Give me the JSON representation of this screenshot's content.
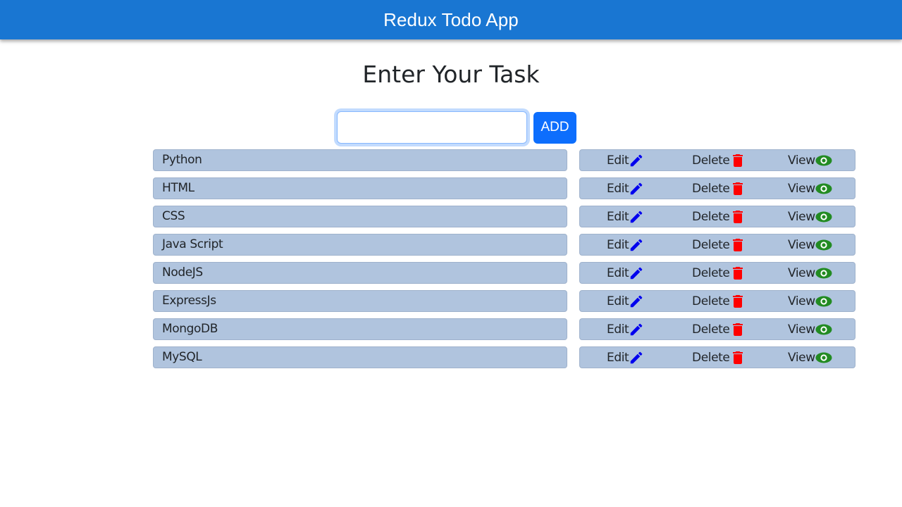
{
  "appbar": {
    "title": "Redux Todo App",
    "color": "#1976d2"
  },
  "heading": "Enter Your Task",
  "input": {
    "value": "",
    "placeholder": ""
  },
  "add_button": {
    "label": "ADD",
    "color": "#0d6efd"
  },
  "row_color": "#b0c4de",
  "actions": {
    "edit_label": "Edit",
    "edit_icon": "pencil-icon",
    "edit_color": "#0000ee",
    "delete_label": "Delete",
    "delete_icon": "trash-icon",
    "delete_color": "#ff0000",
    "view_label": "View",
    "view_icon": "eye-icon",
    "view_color": "#228b22"
  },
  "tasks": [
    {
      "name": "Python"
    },
    {
      "name": "HTML"
    },
    {
      "name": "CSS"
    },
    {
      "name": "Java Script"
    },
    {
      "name": "NodeJS"
    },
    {
      "name": "ExpressJs"
    },
    {
      "name": "MongoDB"
    },
    {
      "name": "MySQL"
    }
  ]
}
